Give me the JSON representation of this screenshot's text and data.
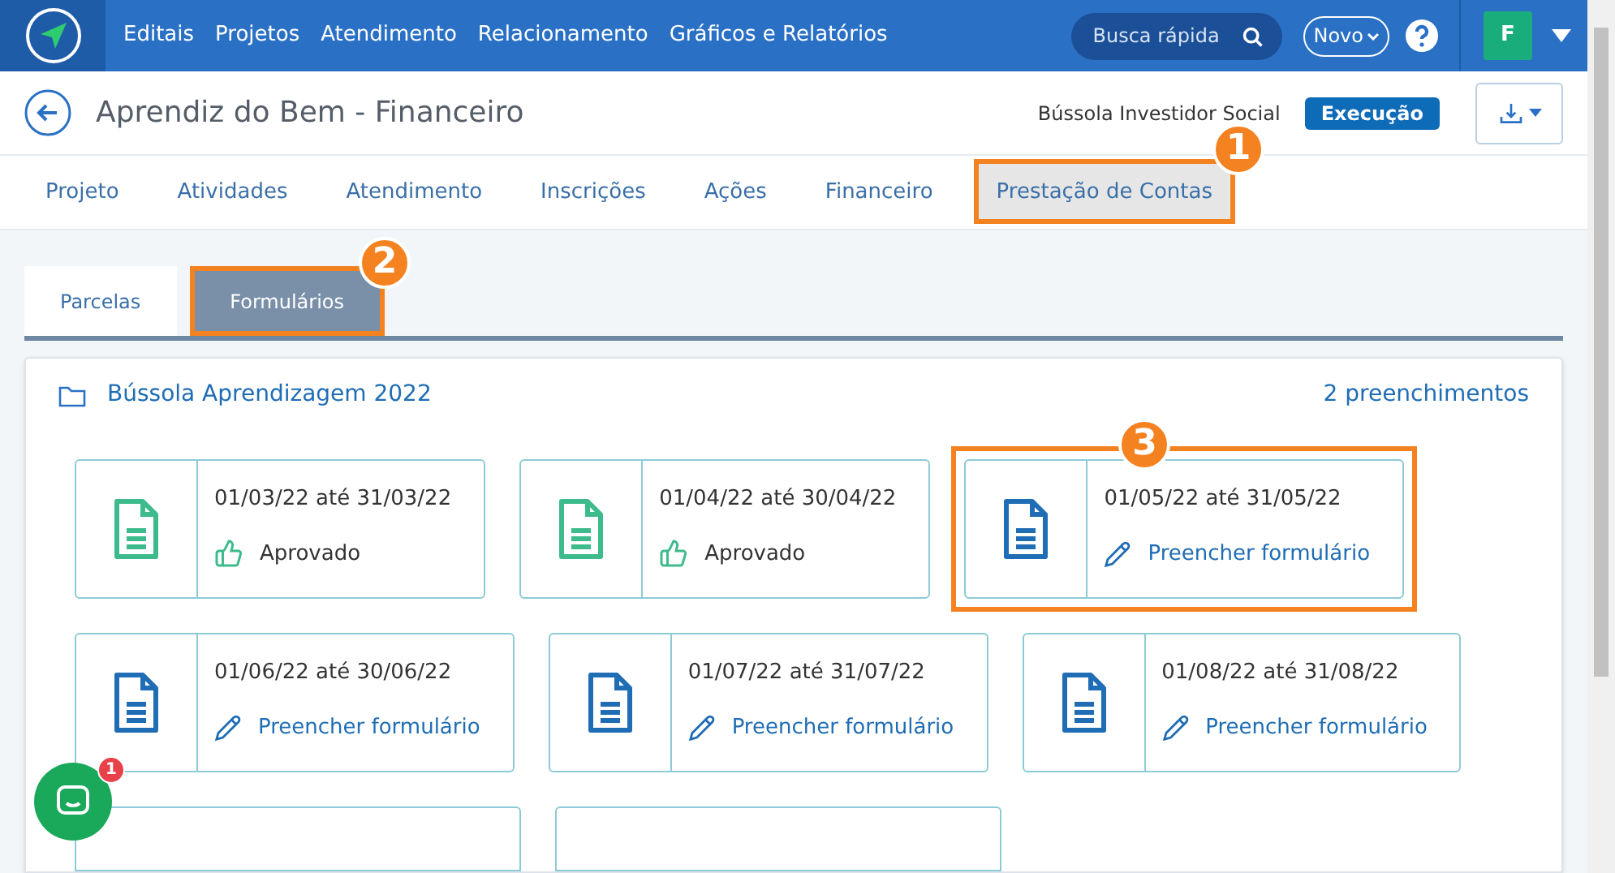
{
  "navbar": {
    "menu": [
      "Editais",
      "Projetos",
      "Atendimento",
      "Relacionamento",
      "Gráficos e Relatórios"
    ],
    "search": {
      "placeholder": "Busca rápida"
    },
    "new_button": "Novo",
    "avatar": "F"
  },
  "header": {
    "title": "Aprendiz do Bem - Financeiro",
    "program": "Bússola Investidor Social",
    "status": "Execução"
  },
  "tabs": [
    {
      "label": "Projeto",
      "selected": false
    },
    {
      "label": "Atividades",
      "selected": false
    },
    {
      "label": "Atendimento",
      "selected": false
    },
    {
      "label": "Inscrições",
      "selected": false
    },
    {
      "label": "Ações",
      "selected": false
    },
    {
      "label": "Financeiro",
      "selected": false
    },
    {
      "label": "Prestação de Contas",
      "selected": true,
      "callout": "1"
    }
  ],
  "subtabs": [
    {
      "label": "Parcelas",
      "selected": false
    },
    {
      "label": "Formulários",
      "selected": true,
      "callout": "2"
    }
  ],
  "panel": {
    "title": "Bússola Aprendizagem 2022",
    "count": "2 preenchimentos",
    "rows": [
      [
        {
          "kind": "approved",
          "period": "01/03/22 até 31/03/22",
          "action": "Aprovado"
        },
        {
          "kind": "approved",
          "period": "01/04/22 até 30/04/22",
          "action": "Aprovado"
        },
        {
          "kind": "pending",
          "period": "01/05/22 até 31/05/22",
          "action": "Preencher formulário",
          "callout": "3"
        }
      ],
      [
        {
          "kind": "pending",
          "period": "01/06/22 até 30/06/22",
          "action": "Preencher formulário"
        },
        {
          "kind": "pending",
          "period": "01/07/22 até 31/07/22",
          "action": "Preencher formulário"
        },
        {
          "kind": "pending",
          "period": "01/08/22 até 31/08/22",
          "action": "Preencher formulário"
        }
      ],
      [
        {
          "kind": "cut"
        },
        {
          "kind": "cut"
        }
      ]
    ]
  },
  "chat": {
    "badge": "1"
  }
}
